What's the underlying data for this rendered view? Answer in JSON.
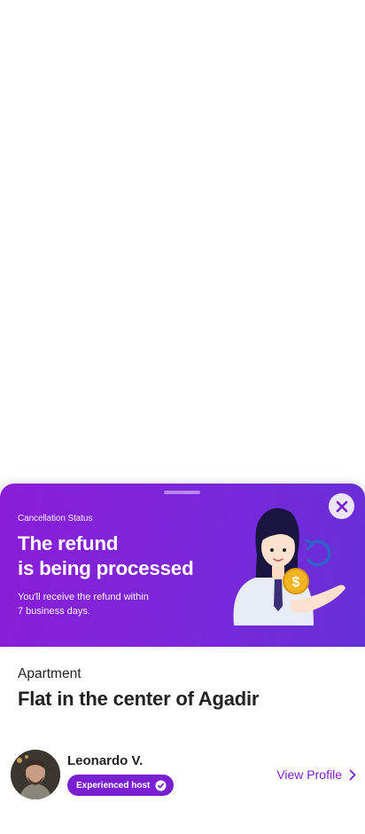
{
  "sheet": {
    "status_label": "Cancellation Status",
    "headline_line1": "The refund",
    "headline_line2": "is being processed",
    "subtext_line1": "You'll receive the refund within",
    "subtext_line2": "7 business days.",
    "close_icon": "close-icon",
    "illustration_icon": "refund-coin-illustration"
  },
  "listing": {
    "type": "Apartment",
    "title": "Flat in the center of Agadir"
  },
  "host": {
    "name": "Leonardo V.",
    "badge": "Experienced host",
    "badge_icon": "verified-check-icon",
    "view_profile": "View Profile",
    "chevron_icon": "chevron-right-icon"
  },
  "colors": {
    "brand_purple": "#7a1fd1",
    "banner_start": "#8a1ed8",
    "banner_end": "#6630d8",
    "coin_gold": "#f2b31e"
  }
}
